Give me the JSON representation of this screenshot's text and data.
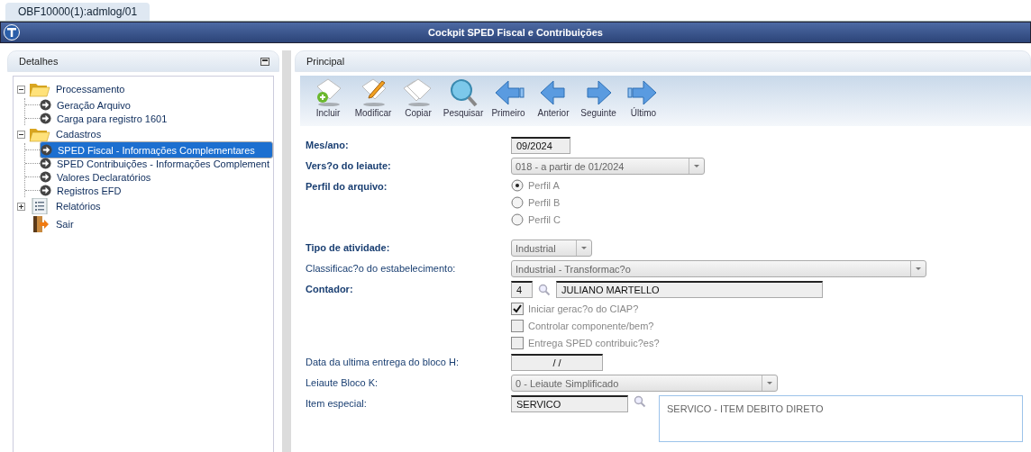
{
  "app_tab": {
    "label": "OBF10000(1):admlog/01",
    "selected": true
  },
  "window": {
    "title": "Cockpit SPED Fiscal e Contribuições"
  },
  "left_panel": {
    "title": "Detalhes",
    "tree": [
      {
        "kind": "folder",
        "label": "Processamento",
        "expanded": true,
        "children": [
          {
            "kind": "action",
            "label": "Geração Arquivo",
            "selected": false
          },
          {
            "kind": "action",
            "label": "Carga para registro 1601",
            "selected": false
          }
        ]
      },
      {
        "kind": "folder",
        "label": "Cadastros",
        "expanded": true,
        "children": [
          {
            "kind": "action",
            "label": "SPED Fiscal - Informações Complementares",
            "selected": true
          },
          {
            "kind": "action",
            "label": "SPED Contribuições - Informações Complement",
            "selected": false
          },
          {
            "kind": "action",
            "label": "Valores Declaratórios",
            "selected": false
          },
          {
            "kind": "action",
            "label": "Registros EFD",
            "selected": false
          }
        ]
      },
      {
        "kind": "list",
        "label": "Relatórios",
        "expanded": false
      },
      {
        "kind": "exit",
        "label": "Sair"
      }
    ]
  },
  "right_panel": {
    "title": "Principal",
    "toolbar": [
      {
        "kind": "add",
        "label": "Incluir"
      },
      {
        "kind": "edit",
        "label": "Modificar"
      },
      {
        "kind": "copy",
        "label": "Copiar"
      },
      {
        "kind": "search",
        "label": "Pesquisar"
      },
      {
        "kind": "first",
        "label": "Primeiro"
      },
      {
        "kind": "previous",
        "label": "Anterior"
      },
      {
        "kind": "next",
        "label": "Seguinte"
      },
      {
        "kind": "last",
        "label": "Último"
      }
    ],
    "form": [
      {
        "kind": "text",
        "label": "Mes/ano:",
        "bold": true,
        "value": "09/2024"
      },
      {
        "kind": "select",
        "label": "Vers?o do leiaute:",
        "bold": true,
        "value": "018 - a partir de 01/2024"
      },
      {
        "kind": "radio",
        "label": "Perfil do arquivo:",
        "bold": true,
        "options": [
          {
            "label": "Perfil A",
            "selected": true
          },
          {
            "label": "Perfil B",
            "selected": false
          },
          {
            "label": "Perfil C",
            "selected": false
          }
        ]
      },
      {
        "kind": "select",
        "label": "Tipo de atividade:",
        "bold": true,
        "value": "Industrial"
      },
      {
        "kind": "select",
        "label": "Classificac?o do estabelecimento:",
        "bold": false,
        "value": "Industrial - Transformac?o"
      },
      {
        "kind": "lookup",
        "label": "Contador:",
        "bold": true,
        "value": "4",
        "description": "JULIANO MARTELLO"
      },
      {
        "kind": "checks",
        "options": [
          {
            "label": "Iniciar gerac?o do CIAP?",
            "checked": true
          },
          {
            "label": "Controlar componente/bem?",
            "checked": false
          },
          {
            "label": "Entrega SPED contribuic?es?",
            "checked": false
          }
        ]
      },
      {
        "kind": "text",
        "label": "Data da ultima entrega do bloco H:",
        "bold": false,
        "value": "/ /"
      },
      {
        "kind": "select",
        "label": "Leiaute Bloco K:",
        "bold": false,
        "value": "0 - Leiaute Simplificado"
      },
      {
        "kind": "memo",
        "label": "Item especial:",
        "bold": false,
        "value": "SERVICO",
        "description": "SERVICO - ITEM DEBITO DIRETO"
      }
    ]
  }
}
